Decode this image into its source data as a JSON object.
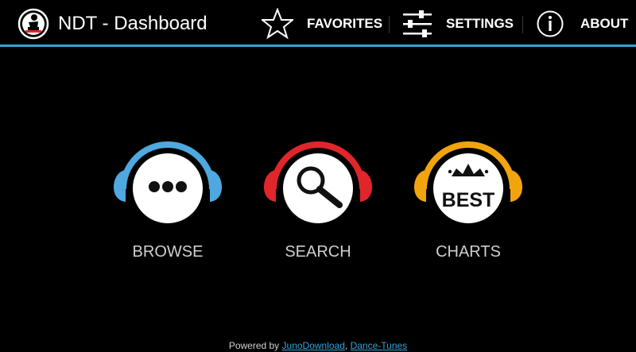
{
  "app": {
    "title": "NDT - Dashboard",
    "accent": "#33a4d8"
  },
  "actions": [
    {
      "label": "FAVORITES",
      "icon": "star-icon"
    },
    {
      "label": "SETTINGS",
      "icon": "sliders-icon"
    },
    {
      "label": "ABOUT",
      "icon": "info-icon"
    }
  ],
  "tiles": [
    {
      "label": "BROWSE",
      "icon": "ellipsis-icon",
      "color": "#4fa8e0"
    },
    {
      "label": "SEARCH",
      "icon": "magnifier-icon",
      "color": "#e0262a"
    },
    {
      "label": "CHARTS",
      "icon": "crown-icon",
      "color": "#f2a40e",
      "badge_text": "BEST"
    }
  ],
  "footer": {
    "prefix": "Powered by ",
    "link1": "JunoDownload",
    "separator": ", ",
    "link2": "Dance-Tunes"
  }
}
